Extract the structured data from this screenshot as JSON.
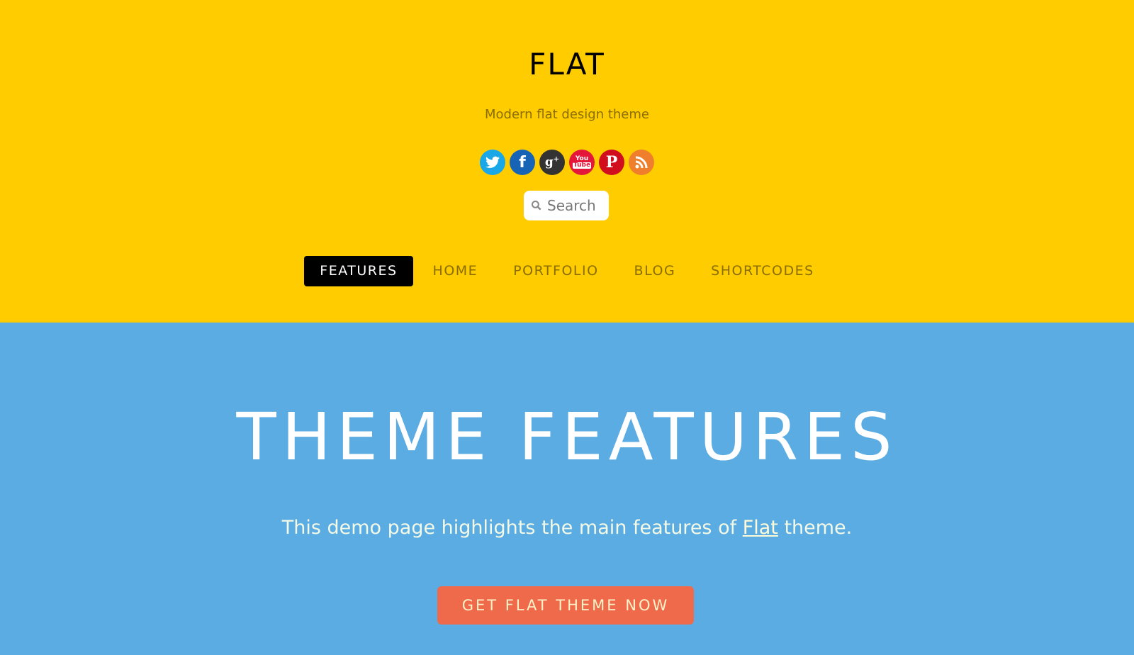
{
  "header": {
    "site_title": "FLAT",
    "tagline": "Modern flat design theme",
    "background_color": "#ffcc00",
    "social_icons": [
      {
        "name": "twitter",
        "glyph": "t",
        "color": "#1aa7e8"
      },
      {
        "name": "facebook",
        "glyph": "f",
        "color": "#1763b5"
      },
      {
        "name": "google-plus",
        "glyph": "g+",
        "color": "#333333"
      },
      {
        "name": "youtube",
        "glyph": "You",
        "color": "#e4173b"
      },
      {
        "name": "pinterest",
        "glyph": "P",
        "color": "#d10e1e"
      },
      {
        "name": "rss",
        "glyph": "rss",
        "color": "#f07f2d"
      }
    ],
    "search": {
      "placeholder": "Search",
      "value": ""
    }
  },
  "nav": {
    "items": [
      {
        "label": "FEATURES",
        "active": true
      },
      {
        "label": "HOME",
        "active": false
      },
      {
        "label": "PORTFOLIO",
        "active": false
      },
      {
        "label": "BLOG",
        "active": false
      },
      {
        "label": "SHORTCODES",
        "active": false
      }
    ]
  },
  "hero": {
    "title": "THEME FEATURES",
    "intro_before": "This demo page highlights the main features of ",
    "intro_link": "Flat",
    "intro_after": " theme.",
    "cta_label": "GET FLAT THEME NOW",
    "background_color": "#5aace2",
    "cta_color": "#ee6a4a"
  }
}
